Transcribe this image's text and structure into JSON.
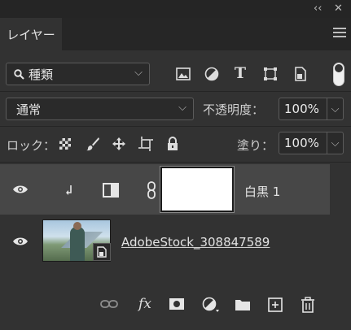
{
  "window": {
    "collapse_glyph": "‹‹",
    "close_glyph": "✕"
  },
  "panel": {
    "tab_label": "レイヤー",
    "menu_icon": "hamburger-menu-icon"
  },
  "filter": {
    "select_value": "種類",
    "icons": [
      "image-filter-icon",
      "adjustment-filter-icon",
      "type-filter-icon",
      "shape-filter-icon",
      "smart-object-filter-icon"
    ]
  },
  "blend": {
    "mode_value": "通常",
    "opacity_label": "不透明度：",
    "opacity_value": "100%"
  },
  "lock": {
    "label": "ロック：",
    "fill_label": "塗り：",
    "fill_value": "100%",
    "icons": [
      "lock-transparent-icon",
      "lock-image-icon",
      "lock-position-icon",
      "lock-artboard-icon",
      "lock-all-icon"
    ]
  },
  "layers": [
    {
      "name": "白黒 1",
      "visible": true,
      "selected": true,
      "type": "adjustment-black-white",
      "clipped": true
    },
    {
      "name": "AdobeStock_308847589",
      "visible": true,
      "selected": false,
      "type": "smart-object"
    }
  ],
  "footer": {
    "fx_label": "fx",
    "icons": [
      "link-layers-icon",
      "fx-icon",
      "add-mask-icon",
      "new-adjustment-icon",
      "new-group-icon",
      "new-layer-icon",
      "delete-layer-icon"
    ]
  },
  "colors": {
    "panel_bg": "#323232",
    "selected_row": "#474747",
    "title_bar": "#252525"
  }
}
